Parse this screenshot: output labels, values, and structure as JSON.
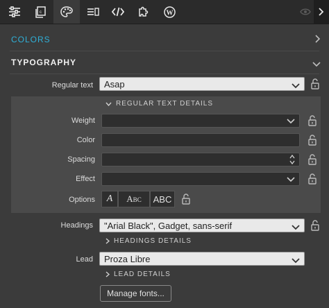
{
  "toolbar": {
    "icons": [
      "sliders-icon",
      "copy-css-icon",
      "palette-icon",
      "list-icon",
      "code-icon",
      "puzzle-icon",
      "wordpress-icon"
    ],
    "active": "palette-icon",
    "right_icons": [
      "eye-icon",
      "chevron-right-icon"
    ]
  },
  "sections": {
    "colors": {
      "title": "COLORS",
      "color": "#2fb0d8"
    },
    "typography": {
      "title": "TYPOGRAPHY"
    }
  },
  "regular": {
    "label": "Regular text",
    "value": "Asap",
    "details_toggle": "REGULAR TEXT DETAILS",
    "weight_label": "Weight",
    "color_label": "Color",
    "spacing_label": "Spacing",
    "effect_label": "Effect",
    "options_label": "Options",
    "options": [
      "A",
      "Abc",
      "ABC"
    ]
  },
  "headings": {
    "label": "Headings",
    "value": "\"Arial Black\", Gadget, sans-serif",
    "details_toggle": "HEADINGS DETAILS"
  },
  "lead": {
    "label": "Lead",
    "value": "Proza Libre",
    "details_toggle": "LEAD DETAILS"
  },
  "manage_fonts": "Manage fonts..."
}
